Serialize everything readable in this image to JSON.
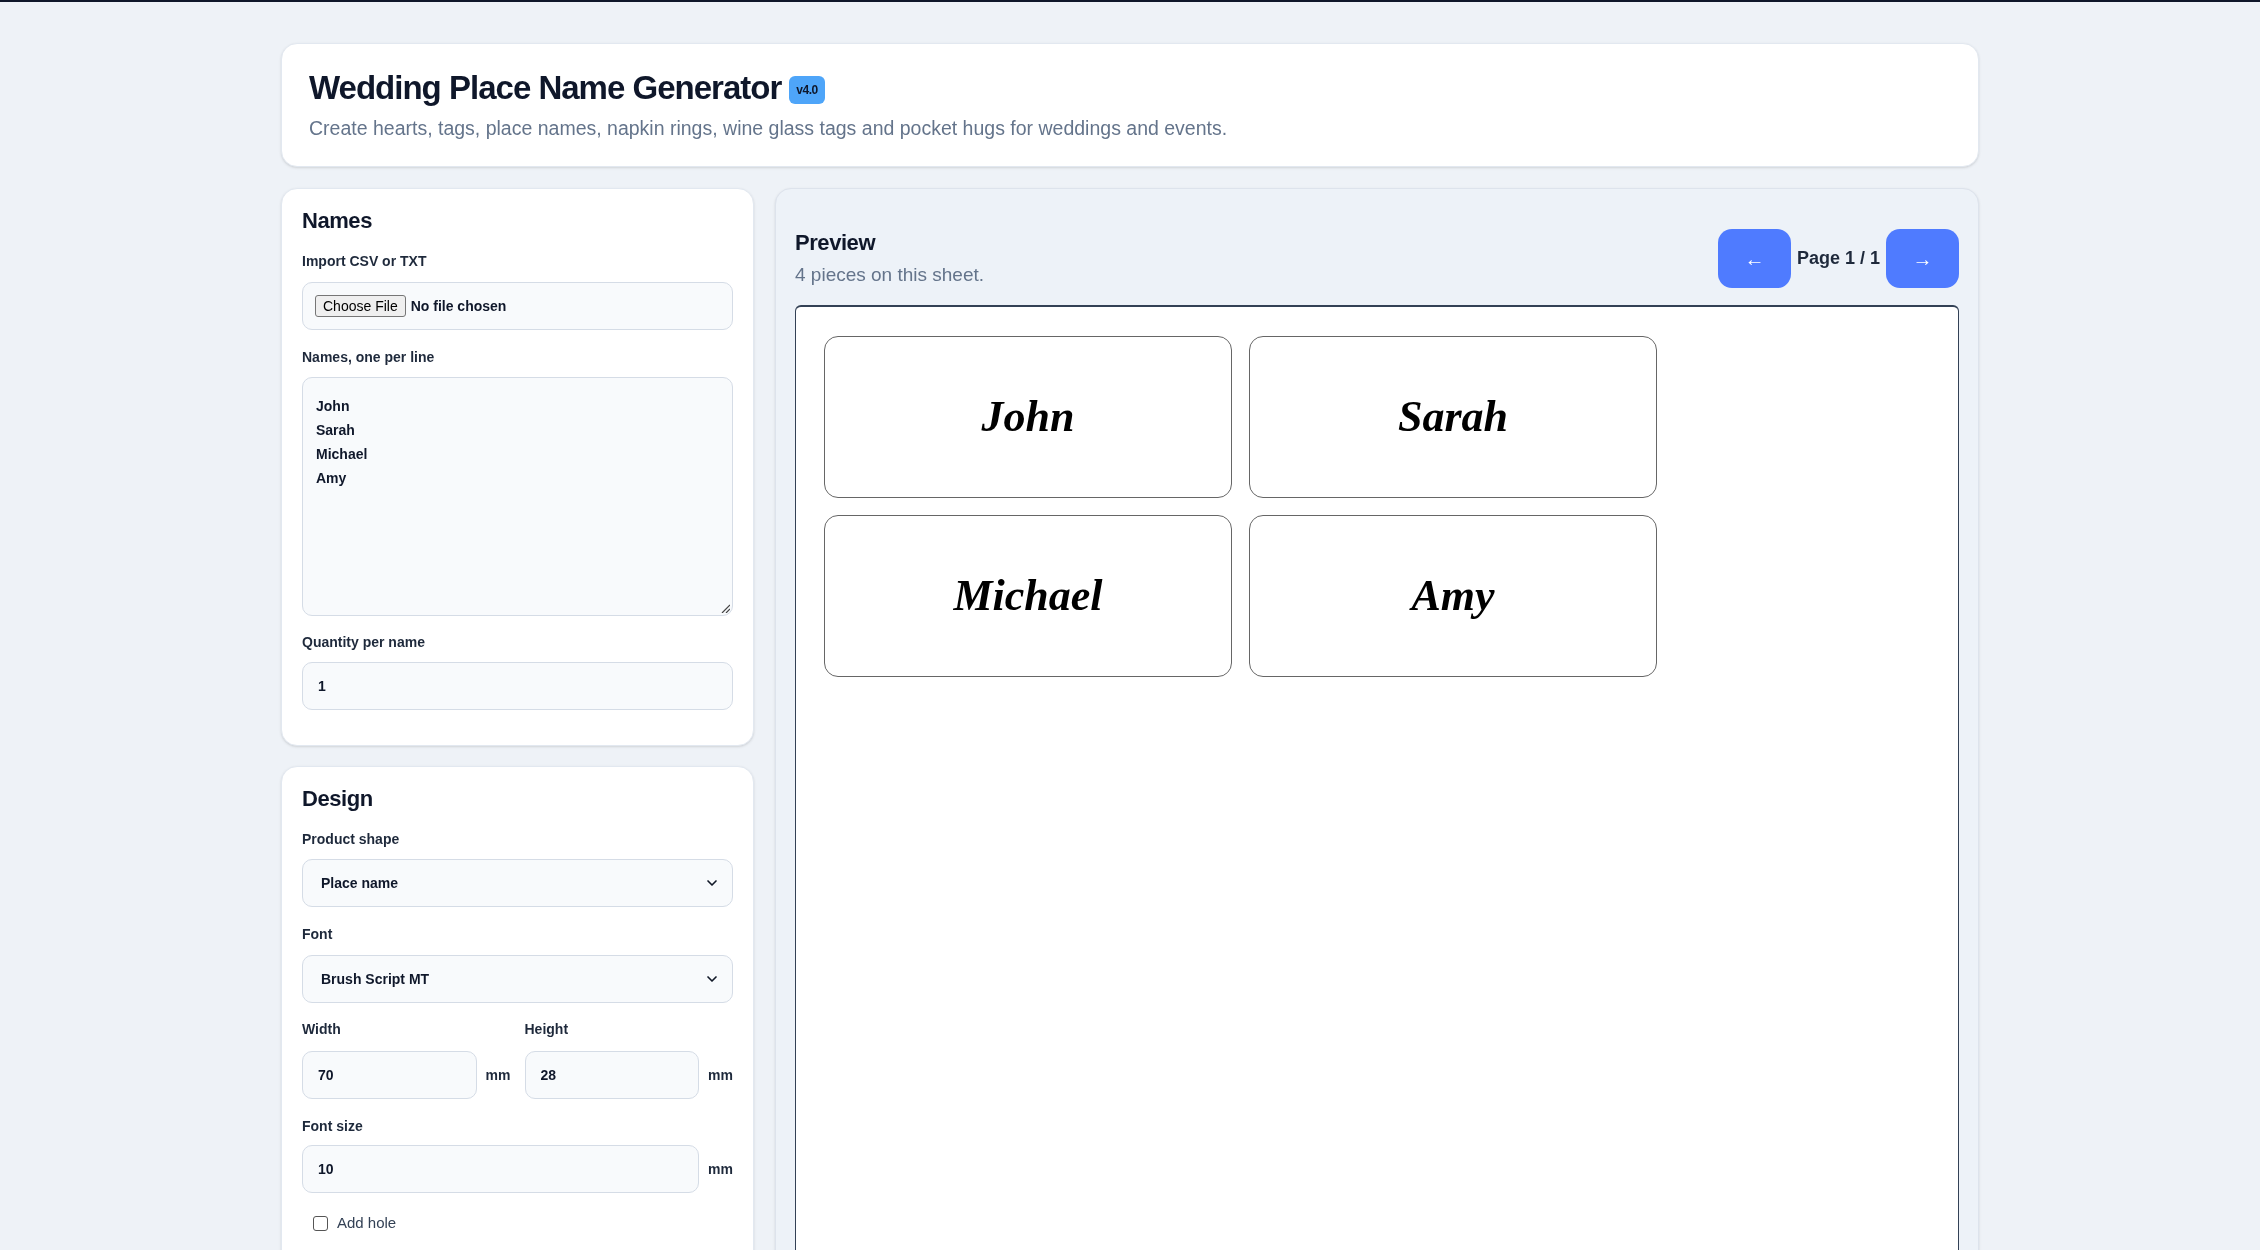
{
  "header": {
    "title": "Wedding Place Name Generator",
    "badge": "v4.0",
    "subtitle": "Create hearts, tags, place names, napkin rings, wine glass tags and pocket hugs for weddings and events."
  },
  "names_panel": {
    "title": "Names",
    "import": {
      "label": "Import CSV or TXT",
      "button": "Choose File",
      "status": "No file chosen"
    },
    "names_field": {
      "label": "Names, one per line",
      "lines": [
        "John",
        "Sarah",
        "Michael",
        "Amy"
      ]
    },
    "quantity": {
      "label": "Quantity per name",
      "value": "1"
    }
  },
  "design_panel": {
    "title": "Design",
    "product_shape": {
      "label": "Product shape",
      "value": "Place name"
    },
    "font": {
      "label": "Font",
      "value": "Brush Script MT"
    },
    "width": {
      "label": "Width",
      "value": "70",
      "unit": "mm"
    },
    "height": {
      "label": "Height",
      "value": "28",
      "unit": "mm"
    },
    "font_size": {
      "label": "Font size",
      "value": "10",
      "unit": "mm"
    },
    "add_hole": {
      "label": "Add hole",
      "checked": false
    }
  },
  "preview": {
    "title": "Preview",
    "summary": "4 pieces on this sheet.",
    "prev_button": "←",
    "page_label": "Page 1 / 1",
    "next_button": "→",
    "pieces": [
      {
        "name": "John"
      },
      {
        "name": "Sarah"
      },
      {
        "name": "Michael"
      },
      {
        "name": "Amy"
      }
    ]
  }
}
